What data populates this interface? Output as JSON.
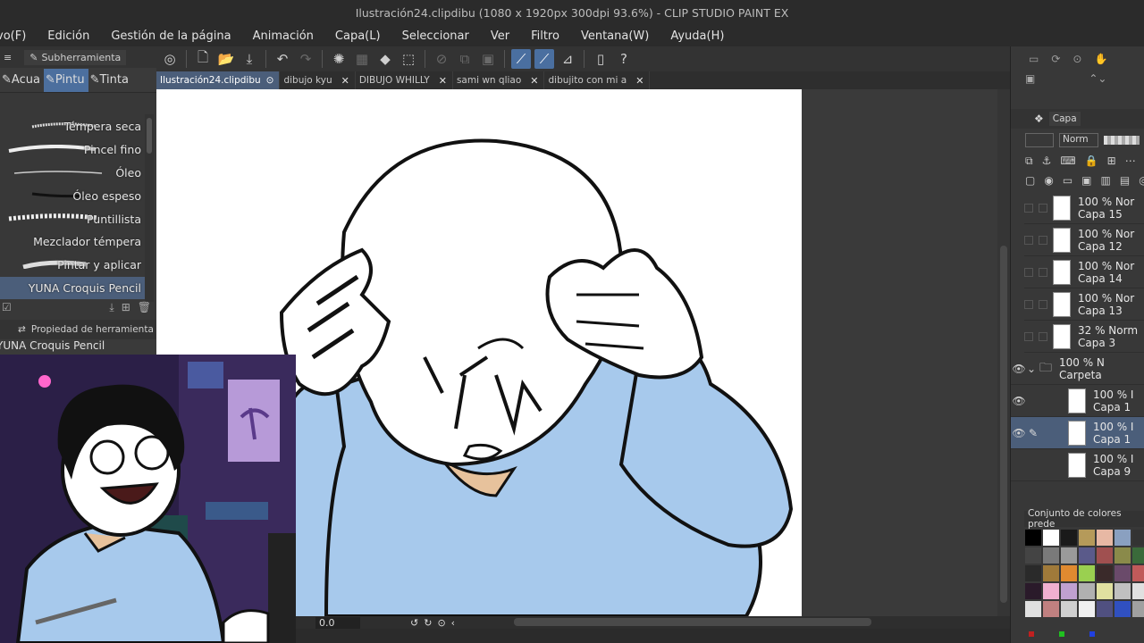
{
  "window": {
    "title": "Ilustración24.clipdibu (1080 x 1920px 300dpi 93.6%)  - CLIP STUDIO PAINT EX"
  },
  "menu": [
    "vo(F)",
    "Edición",
    "Gestión de la página",
    "Animación",
    "Capa(L)",
    "Seleccionar",
    "Ver",
    "Filtro",
    "Ventana(W)",
    "Ayuda(H)"
  ],
  "subtool_panel": {
    "header": "Subherramienta",
    "tabs": [
      "Acua",
      "Pintu",
      "Tinta"
    ],
    "selected_tab": "Pintu",
    "brushes": [
      "Témpera seca",
      "Pincel fino",
      "Óleo",
      "Óleo espeso",
      "Puntillista",
      "Mezclador témpera",
      "Pintar y aplicar",
      "YUNA Croquis Pencil"
    ],
    "selected_brush": "YUNA Croquis Pencil"
  },
  "tool_property": {
    "header": "Propiedad de herramienta",
    "name": "YUNA Croquis Pencil"
  },
  "file_tabs": [
    {
      "label": "Ilustración24.clipdibu",
      "selected": true
    },
    {
      "label": "dibujo kyu",
      "selected": false
    },
    {
      "label": "DIBUJO WHILLY",
      "selected": false
    },
    {
      "label": "sami wn qliao",
      "selected": false
    },
    {
      "label": "dibujito con mi a",
      "selected": false
    }
  ],
  "status": {
    "zoom_field": "0.0"
  },
  "layer_panel": {
    "header": "Capa",
    "blend_mode": "Norm",
    "layers": [
      {
        "opacity": "100 % Nor",
        "name": "Capa 15",
        "visible": false,
        "selected": false
      },
      {
        "opacity": "100 % Nor",
        "name": "Capa 12",
        "visible": false,
        "selected": false
      },
      {
        "opacity": "100 % Nor",
        "name": "Capa 14",
        "visible": false,
        "selected": false
      },
      {
        "opacity": "100 % Nor",
        "name": "Capa 13",
        "visible": false,
        "selected": false
      },
      {
        "opacity": "32 % Norm",
        "name": "Capa 3",
        "visible": false,
        "selected": false
      },
      {
        "opacity": "100 % N",
        "name": "Carpeta",
        "visible": true,
        "selected": false
      },
      {
        "opacity": "100 % I",
        "name": "Capa 1",
        "visible": true,
        "selected": false
      },
      {
        "opacity": "100 % I",
        "name": "Capa 1",
        "visible": true,
        "selected": true
      },
      {
        "opacity": "100 % I",
        "name": "Capa 9",
        "visible": false,
        "selected": false
      }
    ]
  },
  "color_set": {
    "header": "Conjunto de colores prede",
    "colors": [
      "#000000",
      "#ffffff",
      "#1a1a1a",
      "#b59a5a",
      "#e7b8a4",
      "#8aa0c0",
      "#333333",
      "#444444",
      "#7a7a7a",
      "#9a9a9a",
      "#5a5a8a",
      "#a05050",
      "#8a8a4a",
      "#3a6a3a",
      "#2a2a2a",
      "#a07a3a",
      "#e08a30",
      "#9ad050",
      "#3a2a2a",
      "#6a4a6a",
      "#c05a5a",
      "#2a1a2a",
      "#f0b0d0",
      "#c0a0d0",
      "#b0b0b0",
      "#e0e0a0",
      "#c0c0c0",
      "#e0e0e0",
      "#e0e0e0",
      "#c08080",
      "#d0d0d0",
      "#f0f0f0",
      "#505080",
      "#3050c0",
      "#a0a0a0"
    ]
  }
}
